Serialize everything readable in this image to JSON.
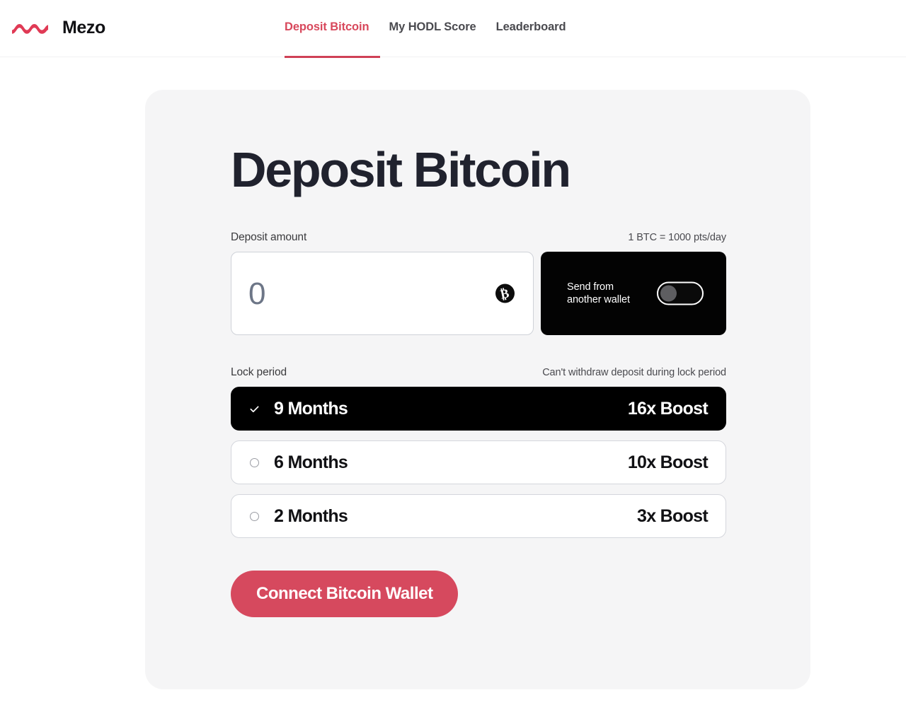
{
  "header": {
    "brand_name": "Mezo",
    "brand_logo_icon": "mezo-wave-logo-icon",
    "nav": [
      {
        "label": "Deposit Bitcoin",
        "active": true
      },
      {
        "label": "My HODL Score",
        "active": false
      },
      {
        "label": "Leaderboard",
        "active": false
      }
    ]
  },
  "main": {
    "title": "Deposit Bitcoin",
    "deposit": {
      "label": "Deposit amount",
      "rate_hint": "1 BTC = 1000 pts/day",
      "input_value": "",
      "input_placeholder": "0",
      "currency_icon": "bitcoin-icon",
      "currency_symbol": "₿"
    },
    "wallet_panel": {
      "label": "Send from\nanother wallet",
      "label_line1": "Send from",
      "label_line2": "another wallet",
      "toggle_state": "off"
    },
    "lock_period": {
      "label": "Lock period",
      "hint": "Can't withdraw deposit during lock period",
      "options": [
        {
          "term": "9 Months",
          "boost": "16x Boost",
          "selected": true
        },
        {
          "term": "6 Months",
          "boost": "10x Boost",
          "selected": false
        },
        {
          "term": "2 Months",
          "boost": "3x Boost",
          "selected": false
        }
      ]
    },
    "cta_label": "Connect Bitcoin Wallet"
  },
  "colors": {
    "accent_red": "#d6495e",
    "nav_active": "#d8485c",
    "card_bg": "#f5f5f6",
    "title": "#20222e",
    "panel_black": "#030303"
  }
}
